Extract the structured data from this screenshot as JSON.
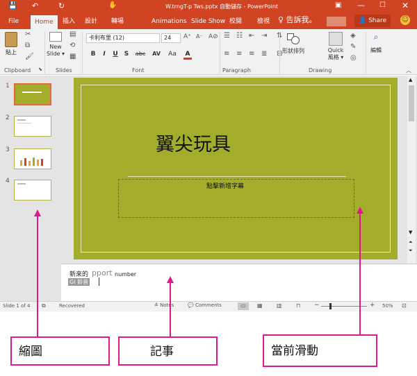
{
  "titlebar": {
    "title": "W.trngT-p  Tws.pptx 自動儲存 - PowerPoint"
  },
  "tabs": [
    "File",
    "Home",
    "插入",
    "設計",
    "轉場",
    "Animations",
    "Slide Show",
    "校閱",
    "檢視",
    "♀ 告訴我。",
    "Share"
  ],
  "ribbon": {
    "groups": [
      "Clipboard",
      "Slides",
      "Font",
      "Paragraph",
      "Drawing"
    ],
    "paste": "貼上",
    "new_slide": "New\nSlide ▾",
    "font_name": "卡利布里  (12)",
    "font_size": "24",
    "shape": "形狀排列",
    "quick": "Quick",
    "styles": "風格 ▾",
    "edit": "編輯",
    "fmt": [
      "B",
      "I",
      "U",
      "S",
      "abc",
      "AV",
      "Aa",
      "A"
    ]
  },
  "thumbs": [
    {
      "n": "1"
    },
    {
      "n": "2"
    },
    {
      "n": "3"
    },
    {
      "n": "4"
    }
  ],
  "slide": {
    "title": "翼尖玩具",
    "subtitle": "點擊新增字幕"
  },
  "notes": {
    "line1a": "新來的",
    "line1b": "pport",
    "line1c": "number",
    "line2": "GI 鈴音"
  },
  "status": {
    "slide": "Slide 1 of 4",
    "recovered": "Recovered",
    "notes": "Notes",
    "comments": "Comments",
    "zoom": "50%"
  },
  "callouts": {
    "thumbnails": "縮圖",
    "notes": "記事",
    "current": "當前滑動"
  },
  "colors": {
    "accent": "#d04423",
    "slide": "#a3ad2b",
    "callout": "#e0198a"
  }
}
